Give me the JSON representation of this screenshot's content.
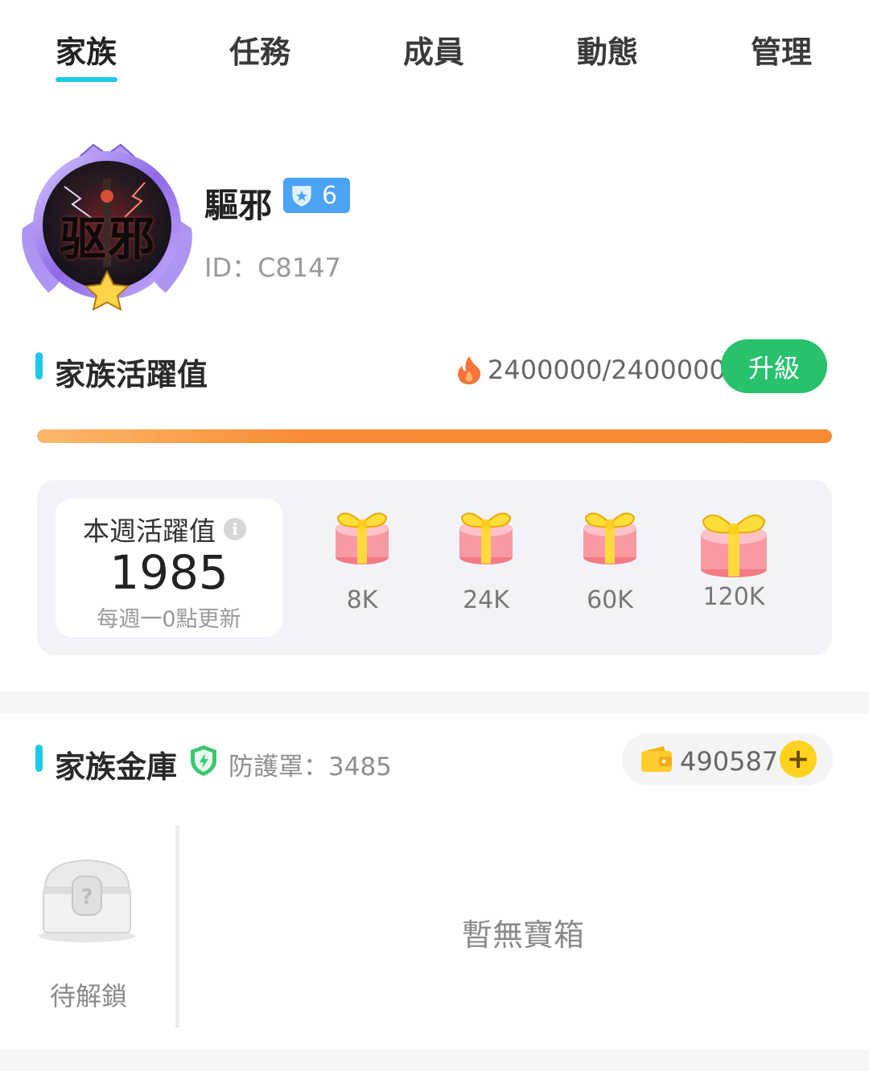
{
  "tabs": [
    {
      "label": "家族",
      "active": true
    },
    {
      "label": "任務",
      "active": false
    },
    {
      "label": "成員",
      "active": false
    },
    {
      "label": "動態",
      "active": false
    },
    {
      "label": "管理",
      "active": false
    }
  ],
  "profile": {
    "avatar_text": "驱邪",
    "name": "驅邪",
    "level": "6",
    "id_text": "ID：C8147"
  },
  "activity": {
    "title": "家族活躍值",
    "value_text": "2400000/2400000",
    "progress_fraction": 1.0,
    "upgrade_label": "升級",
    "weekly_label": "本週活躍值",
    "weekly_value": "1985",
    "weekly_note": "每週一0點更新",
    "rewards": [
      {
        "label": "8K"
      },
      {
        "label": "24K"
      },
      {
        "label": "60K"
      },
      {
        "label": "120K"
      }
    ]
  },
  "vault": {
    "title": "家族金庫",
    "shield_text": "防護罩：3485",
    "coins": "490587",
    "chest_label": "待解鎖",
    "empty_text": "暫無寶箱"
  },
  "colors": {
    "accent": "#1ec8e8",
    "upgrade": "#27c26b",
    "progress": "#f78a33",
    "level_badge": "#4aa3f5",
    "coin": "#ffd21e"
  },
  "icons": [
    "info-icon",
    "flame-icon",
    "shield-bolt-icon",
    "wallet-icon",
    "plus-icon",
    "gift-icon",
    "chest-icon",
    "level-shield-icon"
  ]
}
